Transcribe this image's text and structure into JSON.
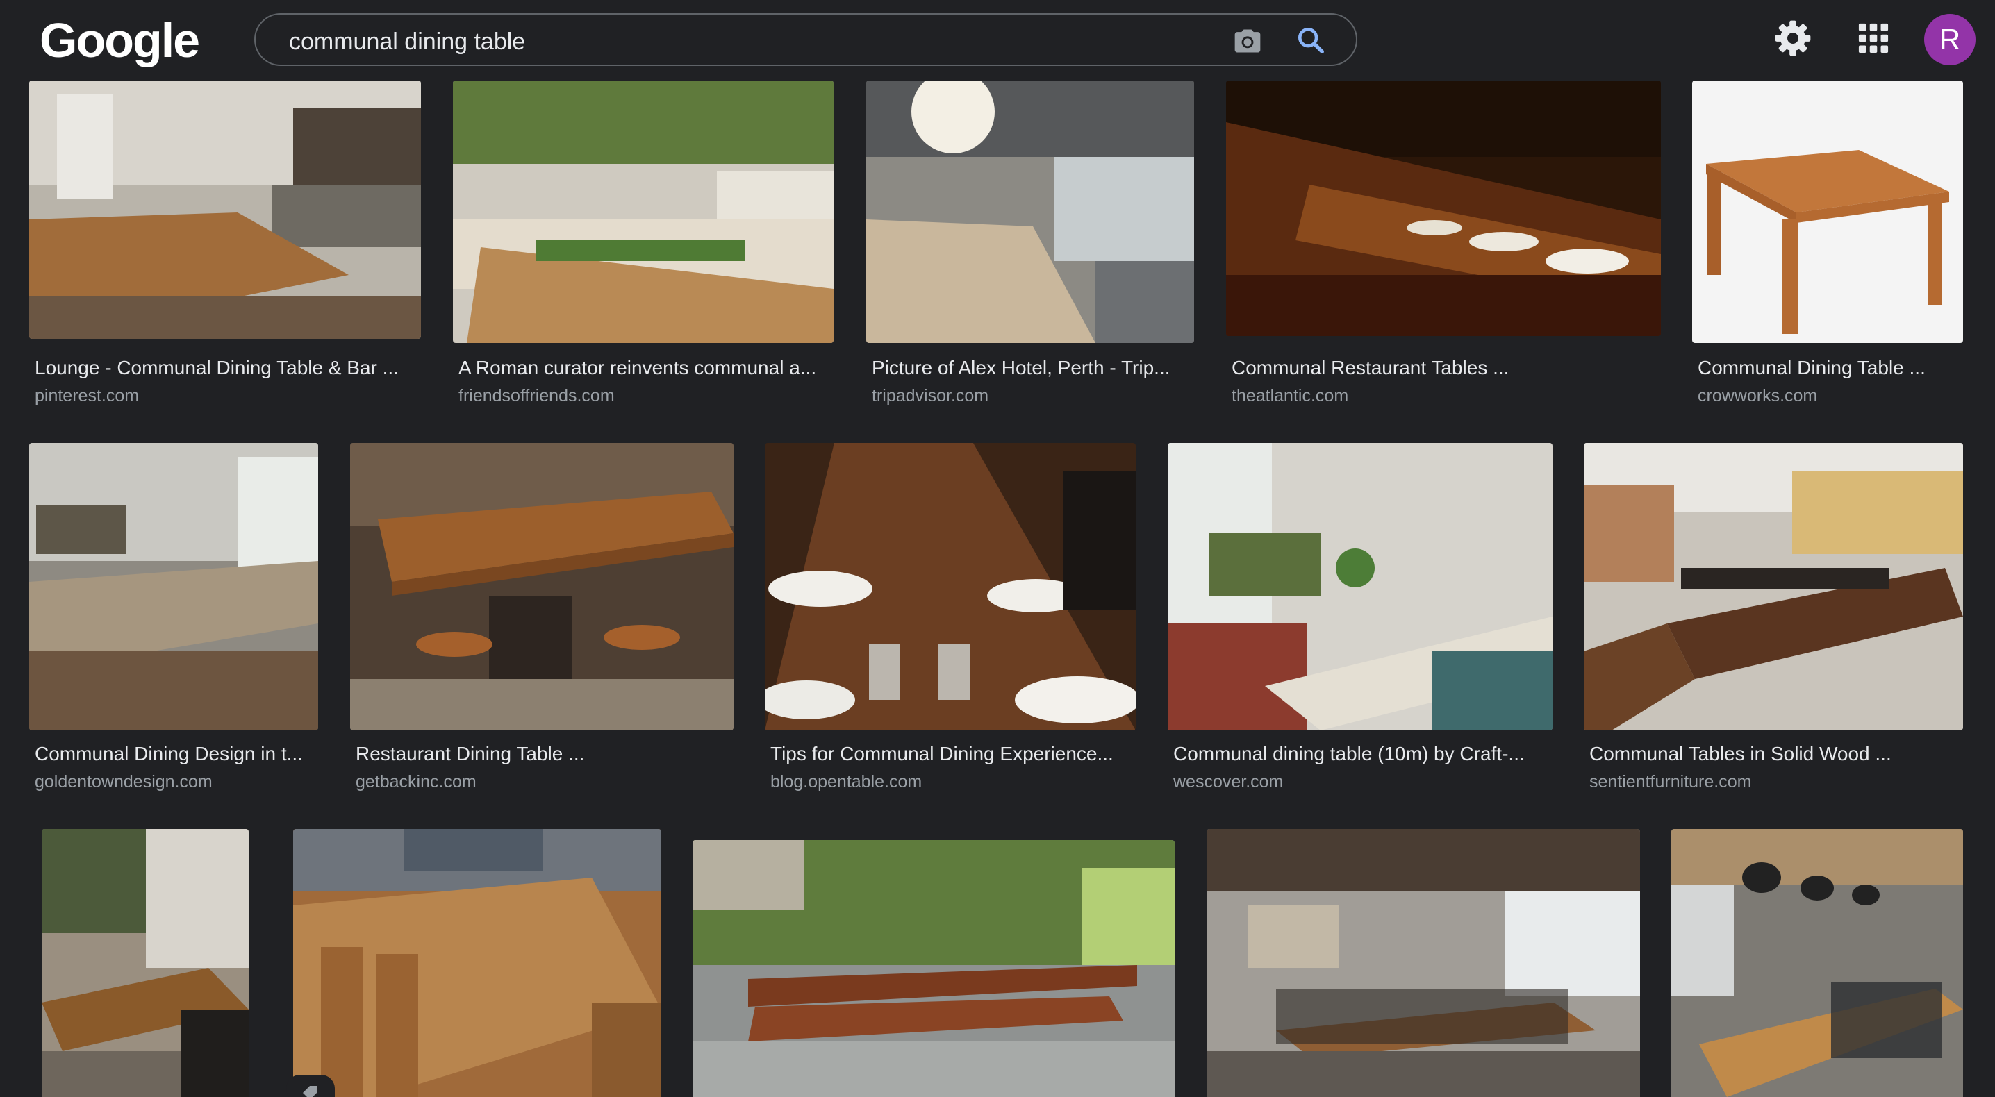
{
  "header": {
    "logo_text": "Google",
    "search_value": "communal dining table",
    "avatar_letter": "R"
  },
  "results": [
    {
      "title": "Lounge - Communal Dining Table & Bar ...",
      "domain": "pinterest.com"
    },
    {
      "title": "A Roman curator reinvents communal a...",
      "domain": "friendsoffriends.com"
    },
    {
      "title": "Picture of Alex Hotel, Perth - Trip...",
      "domain": "tripadvisor.com"
    },
    {
      "title": "Communal Restaurant Tables ...",
      "domain": "theatlantic.com"
    },
    {
      "title": "Communal Dining Table ...",
      "domain": "crowworks.com"
    },
    {
      "title": "Communal Dining Design in t...",
      "domain": "goldentowndesign.com"
    },
    {
      "title": "Restaurant Dining Table ...",
      "domain": "getbackinc.com"
    },
    {
      "title": "Tips for Communal Dining Experience...",
      "domain": "blog.opentable.com"
    },
    {
      "title": "Communal dining table (10m) by Craft-...",
      "domain": "wescover.com"
    },
    {
      "title": "Communal Tables in Solid Wood ...",
      "domain": "sentientfurniture.com"
    }
  ],
  "colors": {
    "background": "#202124",
    "text_primary": "#e8eaed",
    "text_secondary": "#9aa0a6",
    "avatar": "#9334a8"
  },
  "icons": [
    "camera-icon",
    "search-icon",
    "settings-icon",
    "apps-icon",
    "tag-icon"
  ]
}
